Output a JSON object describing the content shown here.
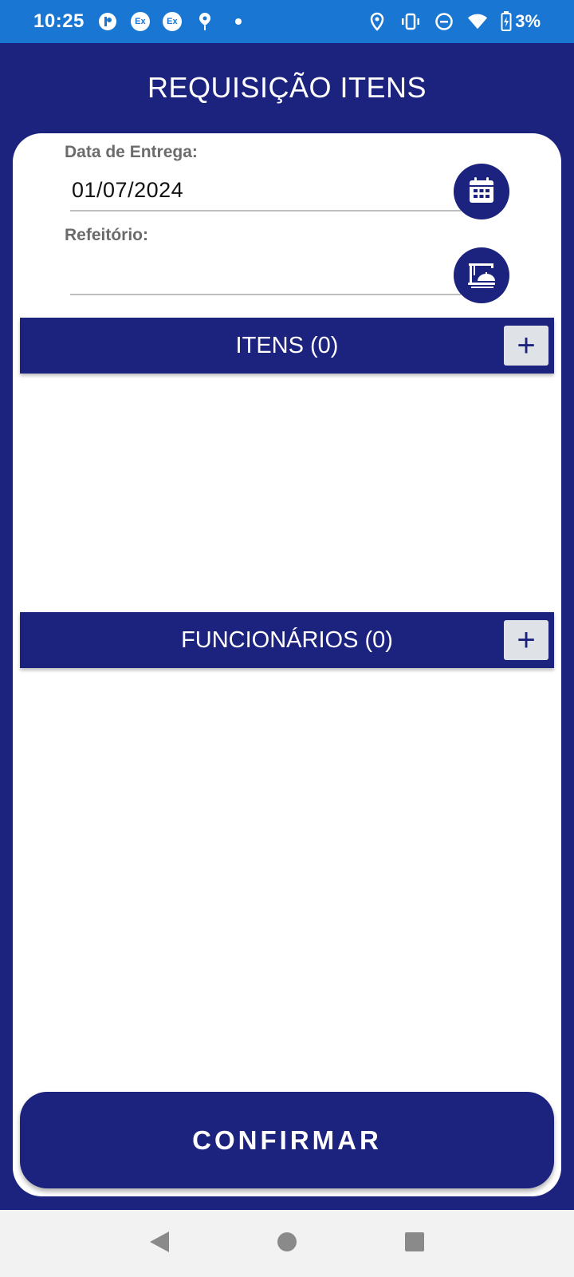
{
  "status_bar": {
    "time": "10:25",
    "battery": "3%",
    "notif_badge_1": "Ex",
    "notif_badge_2": "Ex",
    "icons": [
      "app-icon",
      "ex-icon",
      "ex-icon",
      "location-pin-icon",
      "dot-icon",
      "location-icon",
      "vibrate-icon",
      "dnd-icon",
      "wifi-icon",
      "battery-charging-icon"
    ]
  },
  "header": {
    "title": "REQUISIÇÃO ITENS"
  },
  "form": {
    "delivery_date_label": "Data de Entrega:",
    "delivery_date_value": "01/07/2024",
    "cafeteria_label": "Refeitório:",
    "cafeteria_value": ""
  },
  "sections": {
    "items_title": "ITENS (0)",
    "employees_title": "FUNCIONÁRIOS (0)",
    "add_symbol": "+"
  },
  "actions": {
    "confirm_label": "CONFIRMAR"
  },
  "colors": {
    "primary": "#1c237e",
    "status_bar": "#1976d2",
    "add_button_bg": "#dfe3e8"
  }
}
